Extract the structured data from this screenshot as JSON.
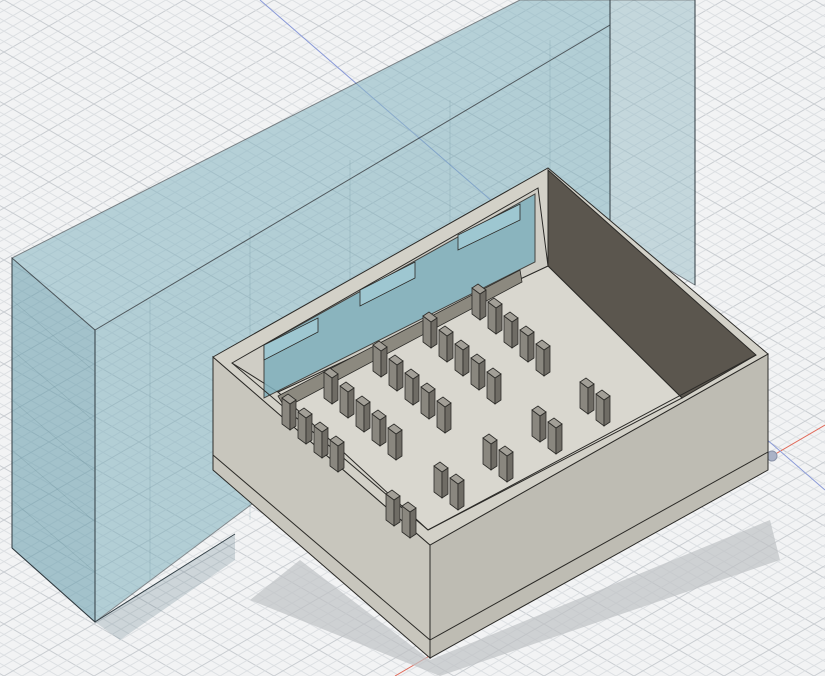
{
  "viewport": {
    "view_style": "isometric",
    "grid_visible": true
  },
  "colors": {
    "background": "#f2f3f4",
    "grid_minor": "#dcdfe2",
    "grid_major": "#c6cace",
    "axis_x": "#e06a5a",
    "axis_y": "#7a8cd6",
    "wall_body_fill": "#7fb0bd",
    "wall_body_edge": "#2f3a40",
    "tray_outer": "#c8c6bd",
    "tray_outer_shade": "#b4b2a9",
    "tray_floor": "#d9d7cf",
    "tray_inner_wall_dark": "#5b564e",
    "tray_edge": "#2b2a27",
    "clip": "#7d7a72",
    "clip_top": "#a29f97"
  },
  "bodies": [
    {
      "name": "transparent-wall-body",
      "appearance": "translucent-blue"
    },
    {
      "name": "storage-tray-body",
      "appearance": "matte-gray"
    }
  ]
}
